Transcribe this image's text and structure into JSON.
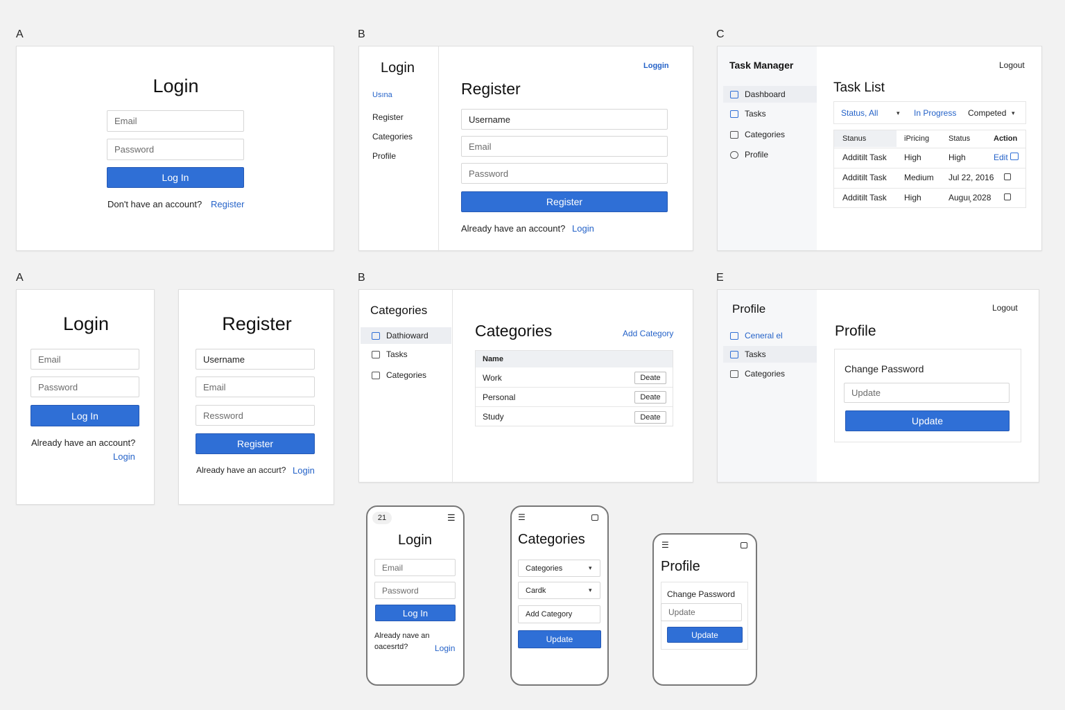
{
  "labels": {
    "a1": "A",
    "b1": "B",
    "c1": "C",
    "a2": "A",
    "b2": "B",
    "e2": "E"
  },
  "loginA": {
    "title": "Login",
    "email_ph": "Email",
    "password_ph": "Password",
    "login_btn": "Log In",
    "no_account": "Don't have an account?",
    "register_link": "Register"
  },
  "registerB": {
    "side_title": "Login",
    "side_items": [
      "Usına",
      "Register",
      "Categories",
      "Profile"
    ],
    "top_link": "Loggin",
    "title": "Register",
    "username": "Username",
    "email_ph": "Email",
    "password_ph": "Password",
    "register_btn": "Register",
    "have_account": "Already have an account?",
    "login_link": "Login"
  },
  "taskC": {
    "app_title": "Task Manager",
    "logout": "Logout",
    "nav": [
      "Dashboard",
      "Tasks",
      "Categories",
      "Profile"
    ],
    "title": "Task List",
    "filters": {
      "status": "Status, All",
      "progress": "In Progress",
      "completed": "Competed"
    },
    "headers": [
      "Stanus",
      "iPricing",
      "Status",
      "Action"
    ],
    "rows": [
      {
        "name": "Additilt Task",
        "priority": "High",
        "status": "High",
        "action": "Edit"
      },
      {
        "name": "Additilt Task",
        "priority": "Medium",
        "status": "Jul 22, 2016",
        "action": ""
      },
      {
        "name": "Additilt Task",
        "priority": "High",
        "status": "Auguı̧ 2028",
        "action": ""
      }
    ]
  },
  "loginA2": {
    "title": "Login",
    "email_ph": "Email",
    "password_ph": "Password",
    "login_btn": "Log In",
    "have_account": "Already have an account?",
    "login_link": "Login"
  },
  "registerA2": {
    "title": "Register",
    "username": "Username",
    "email_ph": "Email",
    "password_ph": "Ressword",
    "register_btn": "Register",
    "have_account": "Already have an accurt?",
    "login_link": "Login"
  },
  "categoriesB": {
    "side_title": "Categories",
    "nav": [
      "Dathioward",
      "Tasks",
      "Categories"
    ],
    "title": "Categories",
    "add_link": "Add Category",
    "col_name": "Name",
    "rows": [
      "Work",
      "Personal",
      "Study"
    ],
    "delete_btn": "Deate"
  },
  "profileE": {
    "side_title": "Profile",
    "logout": "Logout",
    "nav": [
      "Ceneral el",
      "Tasks",
      "Categories"
    ],
    "title": "Profile",
    "change_pw": "Change Password",
    "update_ph": "Update",
    "update_btn": "Update"
  },
  "mobileLogin": {
    "status": "21",
    "title": "Login",
    "email_ph": "Email",
    "password_ph": "Password",
    "login_btn": "Log In",
    "have_account_1": "Already nave an",
    "have_account_2": "oacesrtd?",
    "login_link": "Login"
  },
  "mobileCategories": {
    "title": "Categories",
    "select1": "Categories",
    "select2": "Cardk",
    "add_input": "Add Category",
    "update_btn": "Update"
  },
  "mobileProfile": {
    "title": "Profile",
    "change_pw": "Change Password",
    "update_ph": "Update",
    "update_btn": "Update"
  },
  "colors": {
    "accent": "#2f6fd6",
    "link": "#2462c8",
    "background": "#f2f2f2"
  }
}
